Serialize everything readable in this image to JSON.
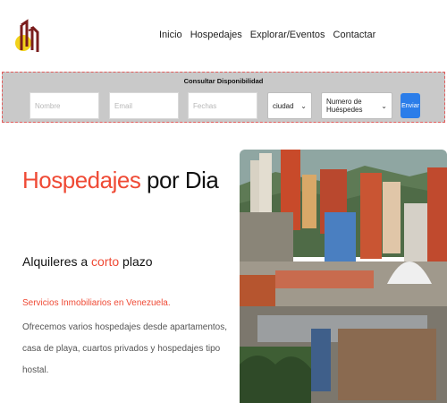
{
  "nav": {
    "items": [
      "Inicio",
      "Hospedajes",
      "Explorar/Eventos",
      "Contactar"
    ]
  },
  "availability": {
    "title": "Consultar Disponibilidad",
    "name_placeholder": "Nombre",
    "email_placeholder": "Email",
    "dates_placeholder": "Fechas",
    "city_value": "ciudad",
    "guests_value": "Numero de Huéspedes",
    "submit_label": "Enviar"
  },
  "hero": {
    "title_highlight": "Hospedajes",
    "title_rest": " por Dia",
    "subtitle_start": "Alquileres a ",
    "subtitle_highlight": "corto",
    "subtitle_end": " plazo",
    "tagline": "Servicios Inmobiliarios en Venezuela.",
    "description": "Ofrecemos varios hospedajes desde apartamentos, casa de playa, cuartos privados y hospedajes tipo hostal."
  },
  "colors": {
    "accent": "#ef4a35",
    "button": "#2b7de9",
    "panel": "#c9c9c9"
  },
  "icons": {
    "logo": "logo-icon",
    "dropdown": "chevron-down-icon"
  }
}
